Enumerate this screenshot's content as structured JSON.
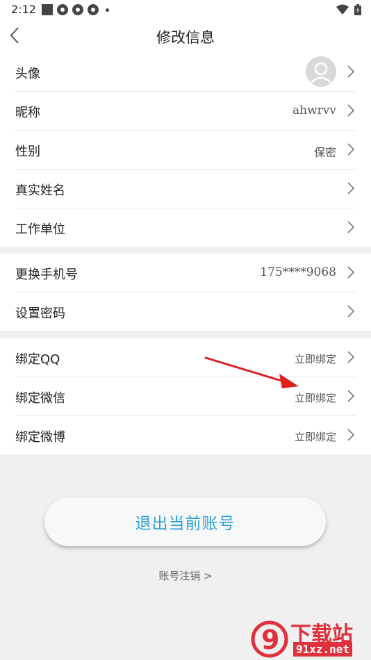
{
  "status_bar": {
    "time": "2:12",
    "icons": [
      "stop-square-icon",
      "notification-icon",
      "notification-icon",
      "notification-icon",
      "more-dot-icon"
    ],
    "right_icons": [
      "wifi-icon",
      "battery-icon"
    ]
  },
  "header": {
    "title": "修改信息",
    "back_icon": "chevron-left-icon"
  },
  "group1": {
    "items": [
      {
        "label": "头像",
        "value": ""
      },
      {
        "label": "昵称",
        "value": "ahwrvv"
      },
      {
        "label": "性别",
        "value": "保密"
      },
      {
        "label": "真实姓名",
        "value": ""
      },
      {
        "label": "工作单位",
        "value": ""
      }
    ]
  },
  "group2": {
    "items": [
      {
        "label": "更换手机号",
        "value": "175****9068"
      },
      {
        "label": "设置密码",
        "value": ""
      }
    ]
  },
  "group3": {
    "items": [
      {
        "label": "绑定QQ",
        "value": "立即绑定"
      },
      {
        "label": "绑定微信",
        "value": "立即绑定"
      },
      {
        "label": "绑定微博",
        "value": "立即绑定"
      }
    ]
  },
  "logout_label": "退出当前账号",
  "cancel_account_label": "账号注销 >",
  "watermark": {
    "text": "下载站",
    "url": "91xz.net",
    "logo_text": "9"
  },
  "colors": {
    "accent": "#2a9fd8",
    "annotation_arrow": "#e02020",
    "watermark": "#e0303c",
    "background": "#f0f0f0"
  }
}
